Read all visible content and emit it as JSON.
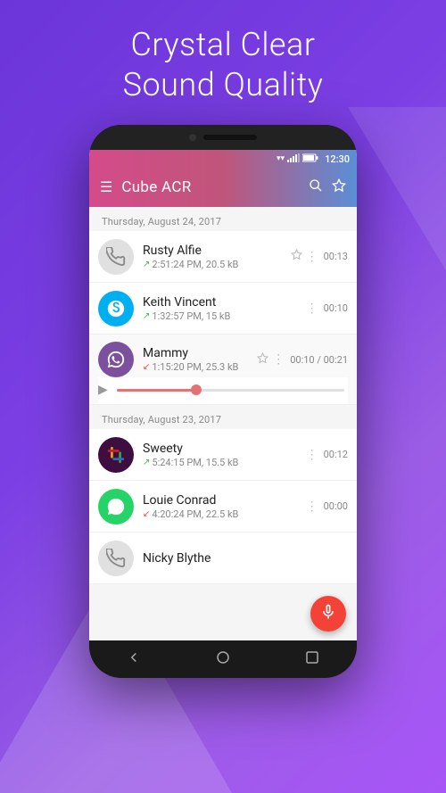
{
  "headline": {
    "line1": "Crystal Clear",
    "line2": "Sound Quality"
  },
  "status_bar": {
    "time": "12:30"
  },
  "app_bar": {
    "title": "Cube ACR"
  },
  "sections": [
    {
      "date": "Thursday, August 24, 2017",
      "items": [
        {
          "id": "rusty-alfie",
          "name": "Rusty Alfie",
          "meta_arrow": "up",
          "meta": "2:51:24 PM, 20.5 kB",
          "duration": "00:13",
          "avatar_type": "phone",
          "has_star": true,
          "has_more": true,
          "expanded": false
        },
        {
          "id": "keith-vincent",
          "name": "Keith Vincent",
          "meta_arrow": "up",
          "meta": "1:32:57 PM, 15 kB",
          "duration": "00:10",
          "avatar_type": "skype",
          "has_star": false,
          "has_more": true,
          "expanded": false
        },
        {
          "id": "mammy",
          "name": "Mammy",
          "meta_arrow": "down",
          "meta": "1:15:20 PM, 25.3 kB",
          "duration": "00:10 / 00:21",
          "avatar_type": "viber",
          "has_star": true,
          "has_more": true,
          "expanded": true,
          "progress": 35
        }
      ]
    },
    {
      "date": "Thursday, August 23, 2017",
      "items": [
        {
          "id": "sweety",
          "name": "Sweety",
          "meta_arrow": "up",
          "meta": "5:24:15 PM, 15.5 kB",
          "duration": "00:12",
          "avatar_type": "slack",
          "has_star": false,
          "has_more": true,
          "expanded": false
        },
        {
          "id": "louie-conrad",
          "name": "Louie Conrad",
          "meta_arrow": "down",
          "meta": "4:20:24 PM, 22.5 kB",
          "duration": "00:00",
          "avatar_type": "whatsapp",
          "has_star": false,
          "has_more": true,
          "expanded": false
        },
        {
          "id": "nicky-blythe",
          "name": "Nicky Blythe",
          "meta_arrow": "up",
          "meta": "",
          "duration": "",
          "avatar_type": "phone",
          "has_star": false,
          "has_more": false,
          "expanded": false
        }
      ]
    }
  ]
}
